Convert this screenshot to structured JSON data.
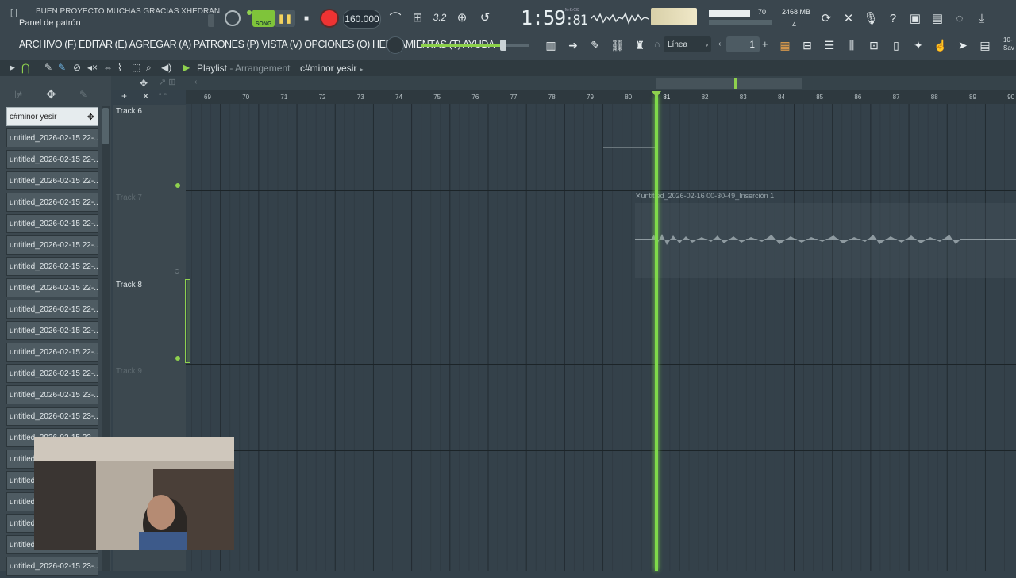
{
  "hint": {
    "title": "BUEN PROYECTO MUCHAS GRACIAS XHEDRAN.",
    "subtitle": "Panel de patrón"
  },
  "transport": {
    "song_label": "SONG",
    "tempo": "160.000",
    "time_main": "1:59",
    "time_sub": ":81",
    "time_unit": "M:S:CS"
  },
  "monitor": {
    "cpu": "70",
    "memory": "2468 MB",
    "polyphony": "4"
  },
  "menu": {
    "text": "ARCHIVO (F) EDITAR (E) AGREGAR (A) PATRONES (P) VISTA (V) OPCIONES (O) HERRAMIENTAS (T) AYUDA"
  },
  "toolbar": {
    "snap": "Línea",
    "pattern_number": "1",
    "save_label": "Sav"
  },
  "playlist": {
    "title": "Playlist",
    "subtitle": "Arrangement",
    "breadcrumb": "c#minor yesir"
  },
  "patterns": [
    "c#minor yesir",
    "untitled_2026-02-15 22-...",
    "untitled_2026-02-15 22-...",
    "untitled_2026-02-15 22-...",
    "untitled_2026-02-15 22-...",
    "untitled_2026-02-15 22-...",
    "untitled_2026-02-15 22-...",
    "untitled_2026-02-15 22-...",
    "untitled_2026-02-15 22-...",
    "untitled_2026-02-15 22-...",
    "untitled_2026-02-15 22-...",
    "untitled_2026-02-15 22-...",
    "untitled_2026-02-15 22-...",
    "untitled_2026-02-15 23-...",
    "untitled_2026-02-15 23-...",
    "untitled_2026-02-15 23-...",
    "untitled",
    "untitled",
    "untitled",
    "untitled",
    "untitled",
    "untitled_2026-02-15 23-..."
  ],
  "tracks": [
    {
      "name": "Track 6"
    },
    {
      "name": "Track 7"
    },
    {
      "name": "Track 8"
    },
    {
      "name": "Track 9"
    }
  ],
  "ruler": [
    "69",
    "70",
    "71",
    "72",
    "73",
    "74",
    "75",
    "76",
    "77",
    "78",
    "79",
    "80",
    "81",
    "82",
    "83",
    "84",
    "85",
    "86",
    "87",
    "88",
    "89",
    "90"
  ],
  "clip": {
    "label": "untitled_2026-02-16 00-30-49_Inserción 1"
  },
  "colors": {
    "accent": "#8fd14e",
    "record": "#e33333",
    "background": "#34414a"
  }
}
